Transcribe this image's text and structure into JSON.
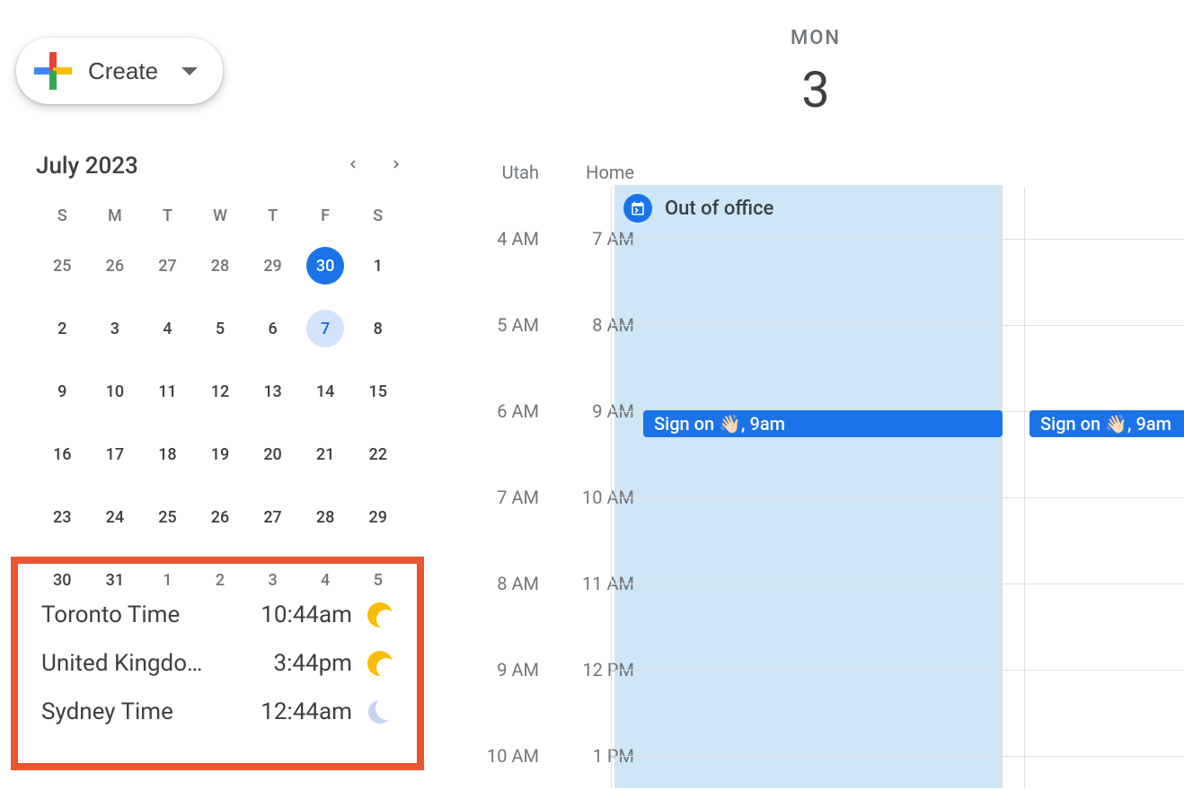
{
  "create_button": {
    "label": "Create"
  },
  "mini_calendar": {
    "title": "July 2023",
    "dow": [
      "S",
      "M",
      "T",
      "W",
      "T",
      "F",
      "S"
    ],
    "weeks": [
      [
        {
          "d": "25",
          "other": true
        },
        {
          "d": "26",
          "other": true
        },
        {
          "d": "27",
          "other": true
        },
        {
          "d": "28",
          "other": true
        },
        {
          "d": "29",
          "other": true
        },
        {
          "d": "30",
          "selected": true
        },
        {
          "d": "1"
        }
      ],
      [
        {
          "d": "2"
        },
        {
          "d": "3"
        },
        {
          "d": "4"
        },
        {
          "d": "5"
        },
        {
          "d": "6"
        },
        {
          "d": "7",
          "highlight": true
        },
        {
          "d": "8"
        }
      ],
      [
        {
          "d": "9"
        },
        {
          "d": "10"
        },
        {
          "d": "11"
        },
        {
          "d": "12"
        },
        {
          "d": "13"
        },
        {
          "d": "14"
        },
        {
          "d": "15"
        }
      ],
      [
        {
          "d": "16"
        },
        {
          "d": "17"
        },
        {
          "d": "18"
        },
        {
          "d": "19"
        },
        {
          "d": "20"
        },
        {
          "d": "21"
        },
        {
          "d": "22"
        }
      ],
      [
        {
          "d": "23"
        },
        {
          "d": "24"
        },
        {
          "d": "25"
        },
        {
          "d": "26"
        },
        {
          "d": "27"
        },
        {
          "d": "28"
        },
        {
          "d": "29"
        }
      ],
      [
        {
          "d": "30"
        },
        {
          "d": "31"
        },
        {
          "d": "1",
          "other": true
        },
        {
          "d": "2",
          "other": true
        },
        {
          "d": "3",
          "other": true
        },
        {
          "d": "4",
          "other": true
        },
        {
          "d": "5",
          "other": true
        }
      ]
    ]
  },
  "world_clocks": [
    {
      "name": "Toronto Time",
      "time": "10:44am",
      "icon": "sun"
    },
    {
      "name": "United Kingdo…",
      "time": "3:44pm",
      "icon": "sun"
    },
    {
      "name": "Sydney Time",
      "time": "12:44am",
      "icon": "moon"
    }
  ],
  "day_view": {
    "dow": "MON",
    "day": "3",
    "tz_headers": [
      "Utah",
      "Home"
    ],
    "time_rows": [
      {
        "tz1": "4 AM",
        "tz2": "7 AM"
      },
      {
        "tz1": "5 AM",
        "tz2": "8 AM"
      },
      {
        "tz1": "6 AM",
        "tz2": "9 AM"
      },
      {
        "tz1": "7 AM",
        "tz2": "10 AM"
      },
      {
        "tz1": "8 AM",
        "tz2": "11 AM"
      },
      {
        "tz1": "9 AM",
        "tz2": "12 PM"
      },
      {
        "tz1": "10 AM",
        "tz2": "1 PM"
      }
    ],
    "out_of_office": "Out of office",
    "events": [
      {
        "title": "Sign on 👋🏻, 9am"
      },
      {
        "title": "Sign on 👋🏻, 9am"
      }
    ]
  }
}
